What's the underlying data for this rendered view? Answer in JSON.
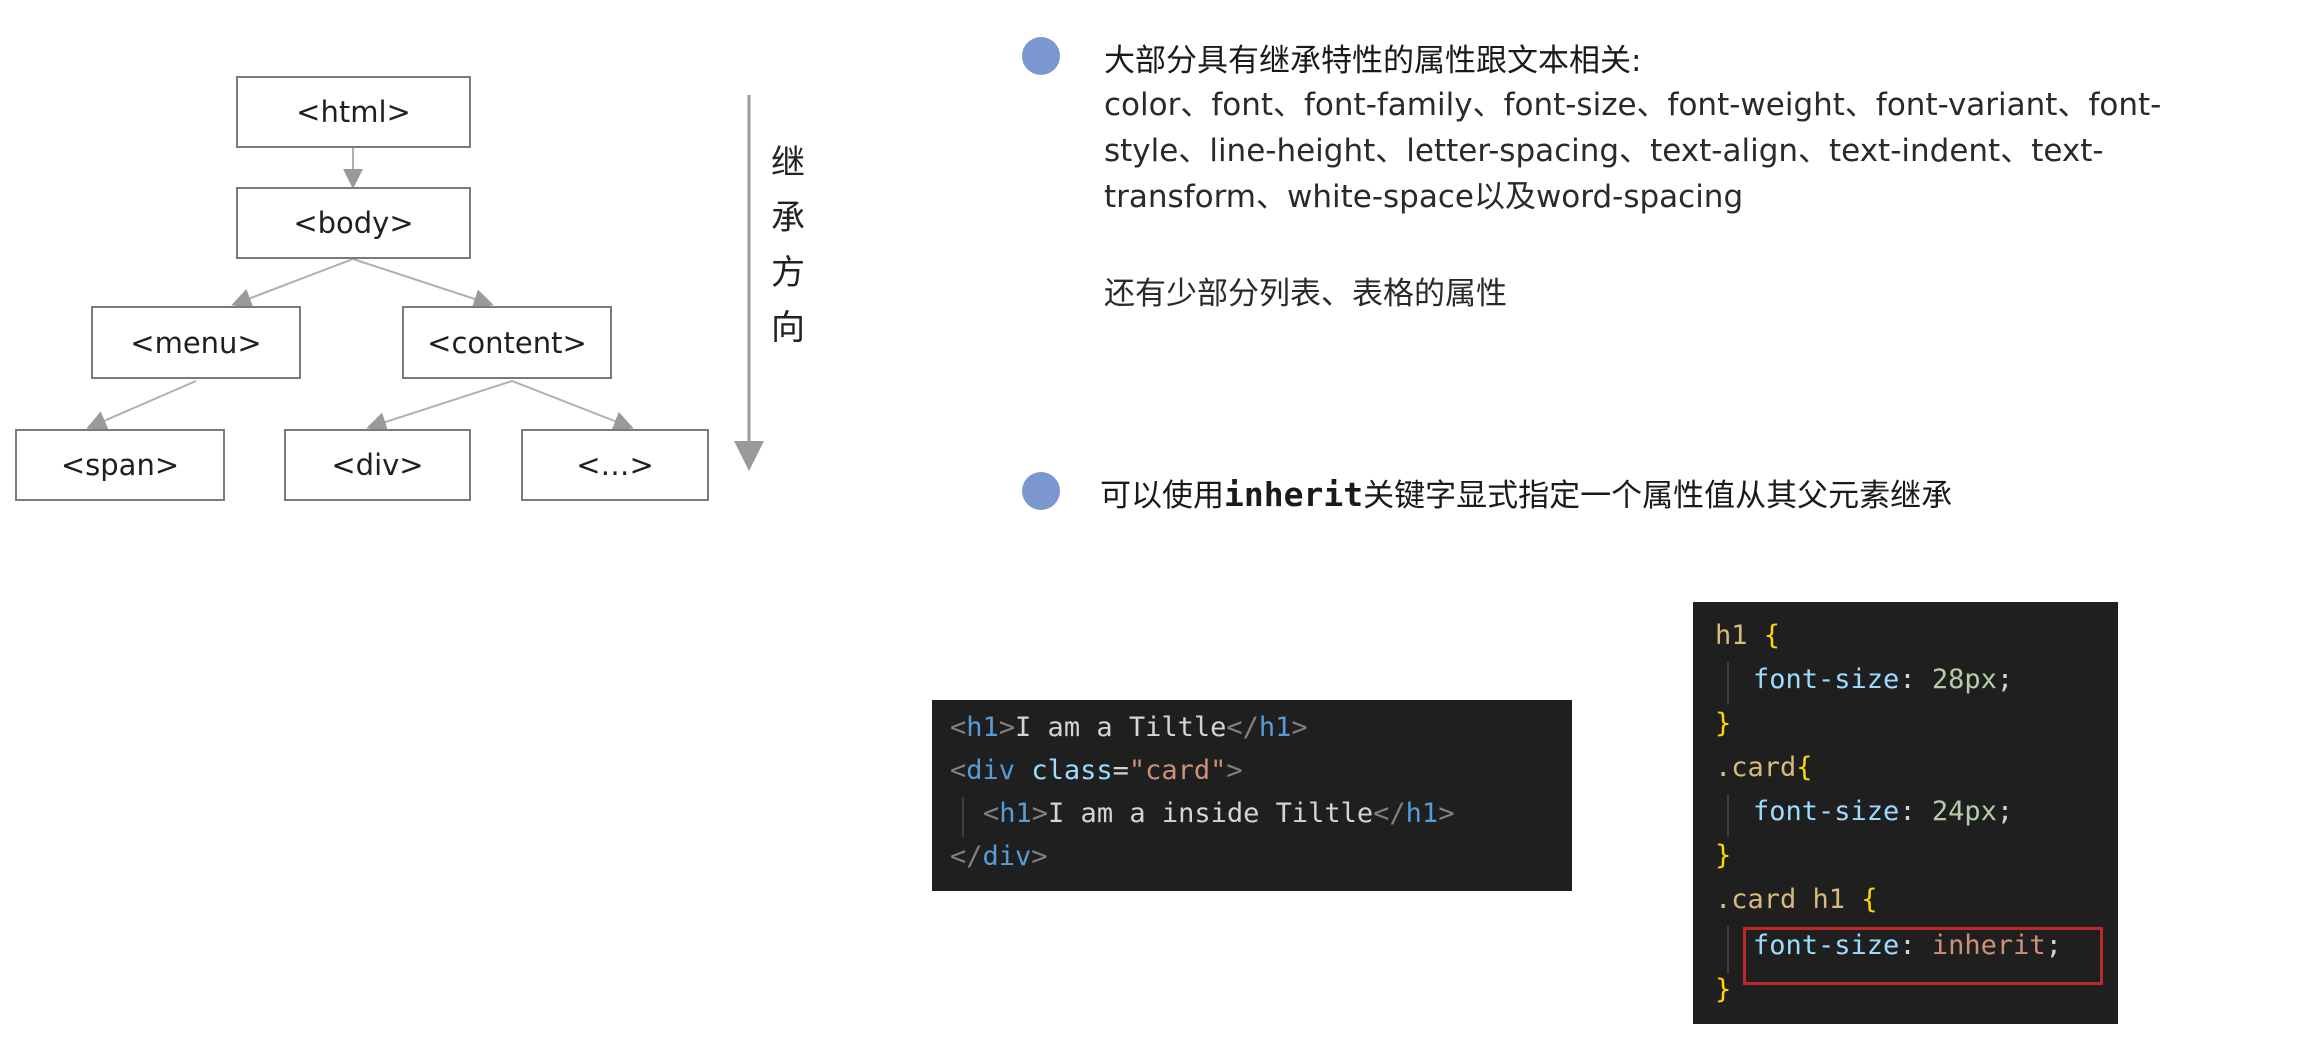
{
  "tree": {
    "nodes": {
      "html": "<html>",
      "body": "<body>",
      "menu": "<menu>",
      "content": "<content>",
      "span": "<span>",
      "div": "<div>",
      "etc": "<…>"
    },
    "direction_label": "继承方向"
  },
  "points": {
    "first": {
      "title": "大部分具有继承特性的属性跟文本相关:",
      "properties": "color、font、font-family、font-size、font-weight、font-variant、font-style、line-height、letter-spacing、text-align、text-indent、text-transform、white-space以及word-spacing",
      "extra": "还有少部分列表、表格的属性"
    },
    "second": {
      "prefix": "可以使用",
      "keyword": "inherit",
      "suffix": "关键字显式指定一个属性值从其父元素继承"
    }
  },
  "html_code": {
    "l1": {
      "tag": "h1",
      "text": "I am a Tiltle"
    },
    "l2": {
      "tag": "div",
      "attr": "class",
      "value": "\"card\""
    },
    "l3": {
      "tag": "h1",
      "text": "I am a inside Tiltle"
    },
    "l4": {
      "tag": "div"
    }
  },
  "css_code": {
    "r1": {
      "selector": "h1",
      "prop": "font-size",
      "value": "28px"
    },
    "r2": {
      "selector": ".card",
      "prop": "font-size",
      "value": "24px"
    },
    "r3": {
      "selector": ".card h1",
      "prop": "font-size",
      "value": "inherit"
    }
  },
  "colors": {
    "bullet": "#7a97cf",
    "code_bg": "#1f1f1f",
    "highlight": "#c0272d"
  }
}
